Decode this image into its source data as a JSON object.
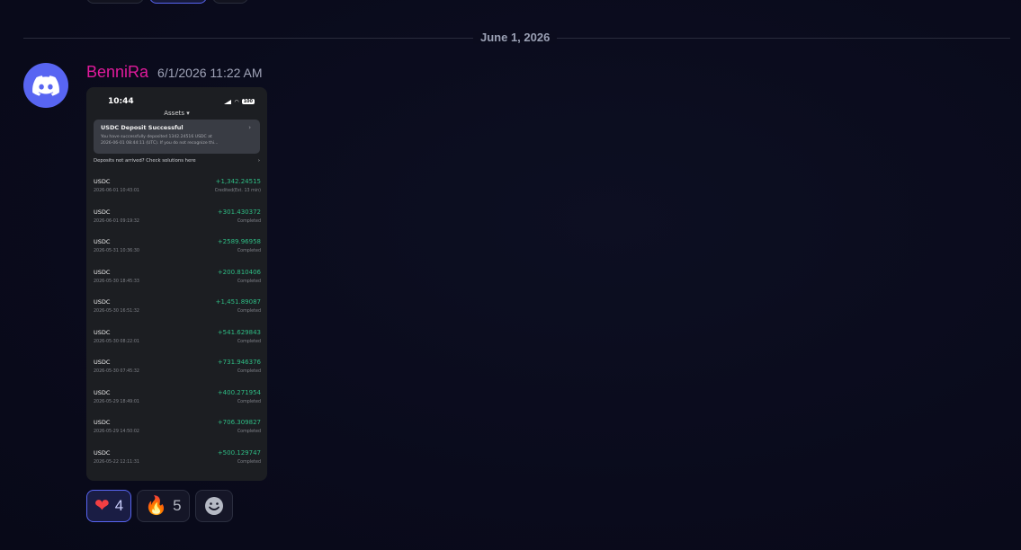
{
  "divider": {
    "date_label": "June 1, 2026"
  },
  "message": {
    "author": "BenniRa",
    "timestamp": "6/1/2026 11:22 AM",
    "avatar_icon": "discord-logo-icon"
  },
  "screenshot": {
    "status_time": "10:44",
    "battery": "100",
    "header_title": "Assets ▾",
    "notification": {
      "title": "USDC Deposit Successful",
      "body_line1": "You have successfully deposited 1342.24516 USDC at",
      "body_line2": "2026-06-01 08:44:11 (UTC). If you do not recognize thi..."
    },
    "help_text": "Deposits not arrived? Check solutions here",
    "transactions": [
      {
        "asset": "USDC",
        "date": "2026-06-01 10:43:01",
        "amount": "+1,342.24515",
        "status": "Credited(Est. 13 min)"
      },
      {
        "asset": "USDC",
        "date": "2026-06-01 09:19:32",
        "amount": "+301.430372",
        "status": "Completed"
      },
      {
        "asset": "USDC",
        "date": "2026-05-31 10:36:30",
        "amount": "+2589.96958",
        "status": "Completed"
      },
      {
        "asset": "USDC",
        "date": "2026-05-30 18:45:33",
        "amount": "+200.810406",
        "status": "Completed"
      },
      {
        "asset": "USDC",
        "date": "2026-05-30 16:51:32",
        "amount": "+1,451.89087",
        "status": "Completed"
      },
      {
        "asset": "USDC",
        "date": "2026-05-30 08:22:01",
        "amount": "+541.629843",
        "status": "Completed"
      },
      {
        "asset": "USDC",
        "date": "2026-05-30 07:45:32",
        "amount": "+731.946376",
        "status": "Completed"
      },
      {
        "asset": "USDC",
        "date": "2026-05-29 18:49:01",
        "amount": "+400.271954",
        "status": "Completed"
      },
      {
        "asset": "USDC",
        "date": "2026-05-29 14:50:02",
        "amount": "+706.309827",
        "status": "Completed"
      },
      {
        "asset": "USDC",
        "date": "2026-05-22 12:11:31",
        "amount": "+500.129747",
        "status": "Completed"
      }
    ]
  },
  "reactions": [
    {
      "emoji": "heart-icon",
      "glyph": "❤",
      "count": "4",
      "active": true
    },
    {
      "emoji": "fire-icon",
      "glyph": "🔥",
      "count": "5",
      "active": false
    }
  ],
  "add_reaction_icon": "smiley-icon",
  "colors": {
    "accent": "#5865f2",
    "author_name": "#e01a9b",
    "positive_amount": "#2fbd85"
  }
}
